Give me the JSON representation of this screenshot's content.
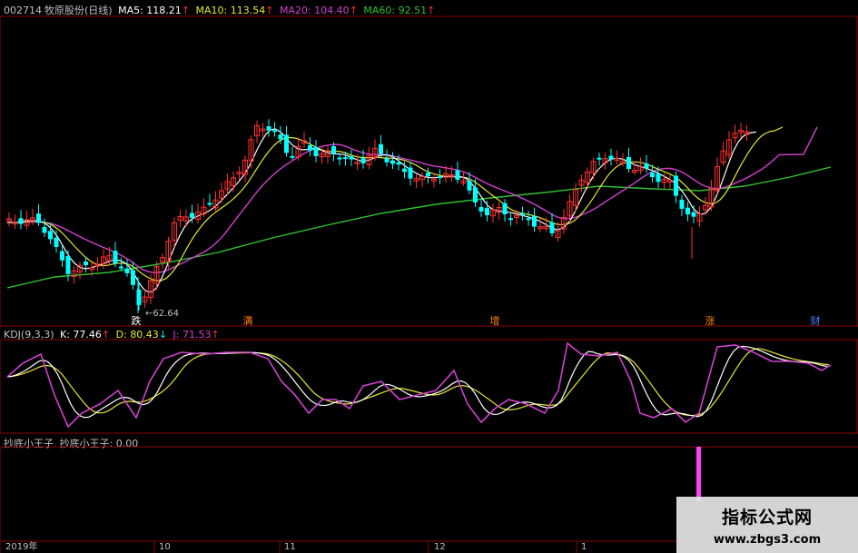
{
  "chart_data": [
    {
      "type": "candlestick",
      "legend": {
        "code": "002714",
        "name": "牧原股份",
        "period": "(日线)",
        "ma5": "MA5: 118.21",
        "ma10": "MA10: 113.54",
        "ma20": "MA20: 104.40",
        "ma60": "MA60: 92.51",
        "arrow": "↑"
      },
      "ma_colors": {
        "ma5": "#ffffff",
        "ma10": "#e6e632",
        "ma20": "#d040d0",
        "ma60": "#30c030"
      },
      "low_label": "62.64",
      "markers": [
        "跌",
        "满",
        "增",
        "涨",
        "财"
      ],
      "marker_colors": [
        "#ffffff",
        "#ff8000",
        "#ff8000",
        "#ff8000",
        "#4080ff"
      ],
      "up_color": "#ff3030",
      "down_color": "#00ffff"
    },
    {
      "type": "line",
      "legend": {
        "name": "KDJ(9,3,3)",
        "k": "K: 77.46",
        "d": "D: 80.43",
        "j": "J: 71.53",
        "k_arrow": "↑",
        "d_arrow": "↓",
        "j_arrow": "↑"
      },
      "series_colors": {
        "k": "#ffffff",
        "d": "#e6e632",
        "j": "#d040d0"
      }
    },
    {
      "type": "bar",
      "legend": {
        "name": "抄底小王子",
        "value": "抄底小王子: 0.00"
      },
      "bar_color": "#ff40ff"
    }
  ],
  "x_axis": {
    "labels": [
      "2019年",
      "10",
      "11",
      "12",
      "1"
    ]
  },
  "watermark": {
    "line1": "指标公式网",
    "line2": "www.zbgs3.com"
  }
}
